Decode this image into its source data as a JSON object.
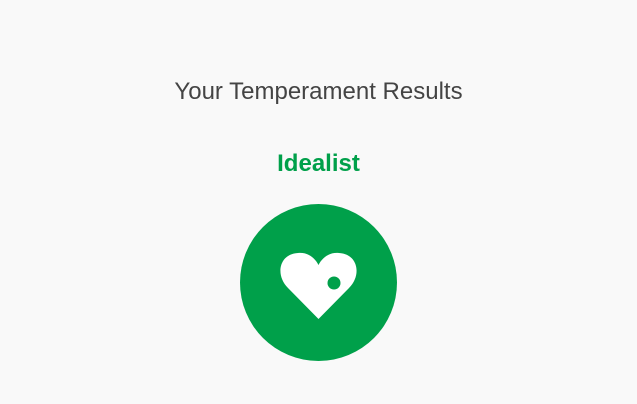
{
  "results": {
    "title": "Your Temperament Results",
    "type_name": "Idealist",
    "icon": "heart-icon"
  },
  "colors": {
    "accent": "#00a04a",
    "title": "#444444",
    "background": "#f9f9f9",
    "icon_fill": "#ffffff"
  }
}
